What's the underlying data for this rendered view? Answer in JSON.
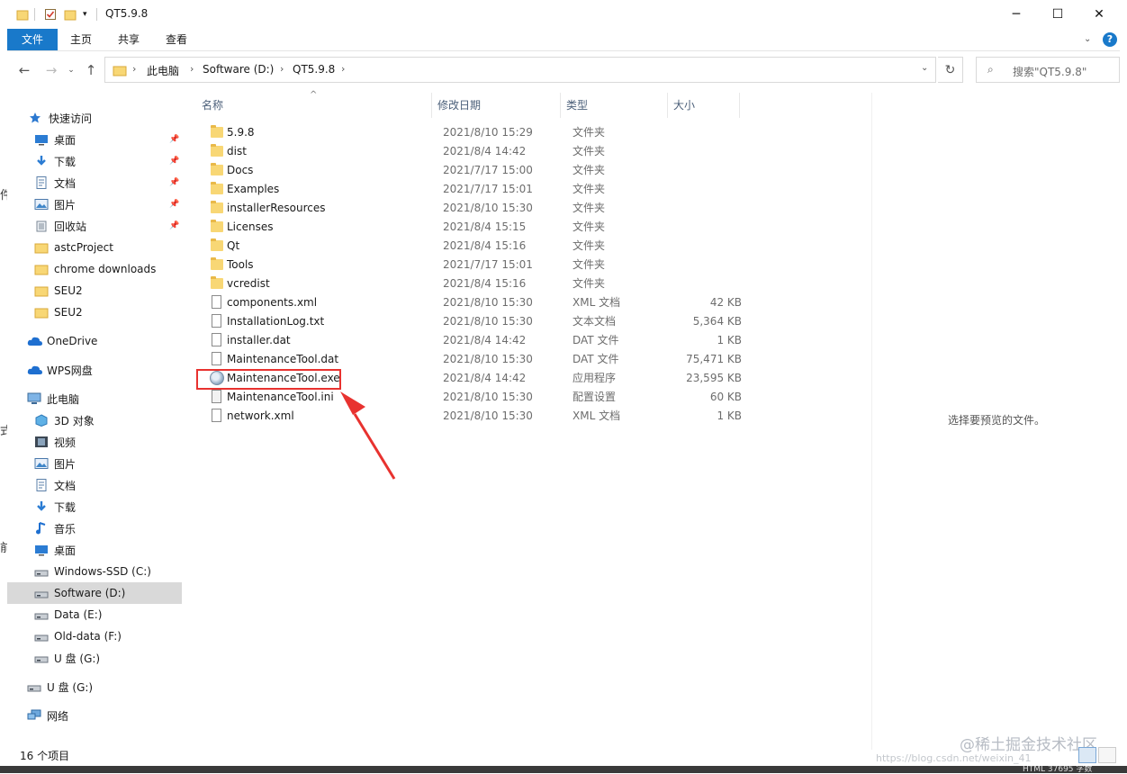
{
  "window": {
    "title": "QT5.9.8",
    "controls": [
      "─",
      "☐",
      "✕"
    ]
  },
  "ribbon": {
    "tabs": [
      "文件",
      "主页",
      "共享",
      "查看"
    ],
    "help": "?"
  },
  "address": {
    "crumbs": [
      "此电脑",
      "Software (D:)",
      "QT5.9.8"
    ]
  },
  "search": {
    "placeholder": "搜索\"QT5.9.8\""
  },
  "nav": {
    "items": [
      {
        "label": "快速访问",
        "icon": "star-icon",
        "pinned": false
      },
      {
        "label": "桌面",
        "icon": "desktop-icon",
        "pinned": true
      },
      {
        "label": "下载",
        "icon": "download-icon",
        "pinned": true
      },
      {
        "label": "文档",
        "icon": "document-icon",
        "pinned": true
      },
      {
        "label": "图片",
        "icon": "picture-icon",
        "pinned": true
      },
      {
        "label": "回收站",
        "icon": "recycle-bin-icon",
        "pinned": true
      },
      {
        "label": "astcProject",
        "icon": "folder-icon",
        "pinned": false
      },
      {
        "label": "chrome downloads",
        "icon": "folder-icon",
        "pinned": false
      },
      {
        "label": "SEU2",
        "icon": "folder-icon",
        "pinned": false
      },
      {
        "label": "SEU2",
        "icon": "folder-icon",
        "pinned": false
      },
      {
        "label": "OneDrive",
        "icon": "cloud-icon",
        "pinned": false
      },
      {
        "label": "WPS网盘",
        "icon": "cloud-icon",
        "pinned": false
      },
      {
        "label": "此电脑",
        "icon": "computer-icon",
        "pinned": false
      },
      {
        "label": "3D 对象",
        "icon": "cube-icon",
        "pinned": false
      },
      {
        "label": "视频",
        "icon": "video-icon",
        "pinned": false
      },
      {
        "label": "图片",
        "icon": "picture-icon",
        "pinned": false
      },
      {
        "label": "文档",
        "icon": "document-icon",
        "pinned": false
      },
      {
        "label": "下载",
        "icon": "download-icon",
        "pinned": false
      },
      {
        "label": "音乐",
        "icon": "music-icon",
        "pinned": false
      },
      {
        "label": "桌面",
        "icon": "desktop-icon",
        "pinned": false
      },
      {
        "label": "Windows-SSD (C:)",
        "icon": "drive-icon",
        "pinned": false
      },
      {
        "label": "Software (D:)",
        "icon": "drive-icon",
        "pinned": false,
        "selected": true
      },
      {
        "label": "Data (E:)",
        "icon": "drive-icon",
        "pinned": false
      },
      {
        "label": "Old-data (F:)",
        "icon": "drive-icon",
        "pinned": false
      },
      {
        "label": "U 盘 (G:)",
        "icon": "drive-icon",
        "pinned": false
      },
      {
        "label": "U 盘 (G:)",
        "icon": "usb-drive-icon",
        "pinned": false
      },
      {
        "label": "网络",
        "icon": "network-icon",
        "pinned": false
      }
    ]
  },
  "columns": [
    "名称",
    "修改日期",
    "类型",
    "大小"
  ],
  "files": [
    {
      "name": "5.9.8",
      "date": "2021/8/10 15:29",
      "type": "文件夹",
      "size": "",
      "kind": "folder"
    },
    {
      "name": "dist",
      "date": "2021/8/4 14:42",
      "type": "文件夹",
      "size": "",
      "kind": "folder"
    },
    {
      "name": "Docs",
      "date": "2021/7/17 15:00",
      "type": "文件夹",
      "size": "",
      "kind": "folder"
    },
    {
      "name": "Examples",
      "date": "2021/7/17 15:01",
      "type": "文件夹",
      "size": "",
      "kind": "folder"
    },
    {
      "name": "installerResources",
      "date": "2021/8/10 15:30",
      "type": "文件夹",
      "size": "",
      "kind": "folder"
    },
    {
      "name": "Licenses",
      "date": "2021/8/4 15:15",
      "type": "文件夹",
      "size": "",
      "kind": "folder"
    },
    {
      "name": "Qt",
      "date": "2021/8/4 15:16",
      "type": "文件夹",
      "size": "",
      "kind": "folder"
    },
    {
      "name": "Tools",
      "date": "2021/7/17 15:01",
      "type": "文件夹",
      "size": "",
      "kind": "folder"
    },
    {
      "name": "vcredist",
      "date": "2021/8/4 15:16",
      "type": "文件夹",
      "size": "",
      "kind": "folder"
    },
    {
      "name": "components.xml",
      "date": "2021/8/10 15:30",
      "type": "XML 文档",
      "size": "42 KB",
      "kind": "file"
    },
    {
      "name": "InstallationLog.txt",
      "date": "2021/8/10 15:30",
      "type": "文本文档",
      "size": "5,364 KB",
      "kind": "file"
    },
    {
      "name": "installer.dat",
      "date": "2021/8/4 14:42",
      "type": "DAT 文件",
      "size": "1 KB",
      "kind": "file"
    },
    {
      "name": "MaintenanceTool.dat",
      "date": "2021/8/10 15:30",
      "type": "DAT 文件",
      "size": "75,471 KB",
      "kind": "file"
    },
    {
      "name": "MaintenanceTool.exe",
      "date": "2021/8/4 14:42",
      "type": "应用程序",
      "size": "23,595 KB",
      "kind": "exe"
    },
    {
      "name": "MaintenanceTool.ini",
      "date": "2021/8/10 15:30",
      "type": "配置设置",
      "size": "60 KB",
      "kind": "ini"
    },
    {
      "name": "network.xml",
      "date": "2021/8/10 15:30",
      "type": "XML 文档",
      "size": "1 KB",
      "kind": "file"
    }
  ],
  "preview": {
    "empty_text": "选择要预览的文件。"
  },
  "status": {
    "count": "16 个项目"
  },
  "watermark": {
    "text": "@稀土掘金技术社区",
    "url": "https://blog.csdn.net/weixin_41"
  },
  "behind": {
    "fragments": [
      "件",
      "式",
      "前"
    ],
    "bottom_text": "HTML 37695 字数"
  },
  "colors": {
    "accent": "#1979ca",
    "highlight_box": "#e8322f",
    "arrow": "#e8322f",
    "folder": "#f8d775"
  }
}
